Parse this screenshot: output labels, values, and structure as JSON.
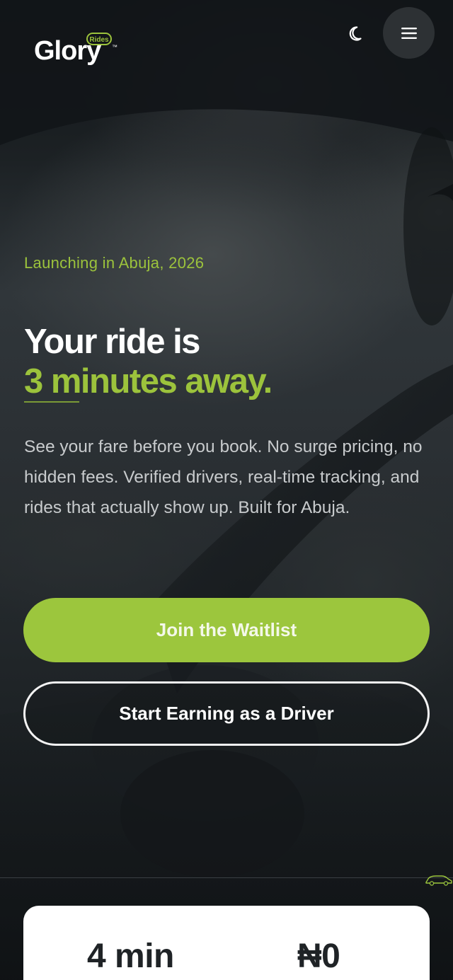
{
  "brand": {
    "logo_text": "Glory",
    "badge": "Rides",
    "tm": "™"
  },
  "header": {
    "theme_icon": "moon-icon",
    "menu_icon": "hamburger-menu-icon"
  },
  "hero": {
    "eyebrow": "Launching in Abuja, 2026",
    "headline_line1": "Your ride is",
    "headline_line2": "3 minutes away.",
    "description": "See your fare before you book. No surge pricing, no hidden fees. Verified drivers, real-time tracking, and rides that actually show up. Built for Abuja.",
    "primary_cta": "Join the Waitlist",
    "secondary_cta": "Start Earning as a Driver"
  },
  "stats": [
    {
      "value": "4 min"
    },
    {
      "value": "₦0"
    }
  ],
  "colors": {
    "accent": "#9cc63d",
    "background": "#15191d",
    "card": "#ffffff",
    "text_primary": "#ffffff",
    "text_secondary": "#c8cbcd"
  }
}
